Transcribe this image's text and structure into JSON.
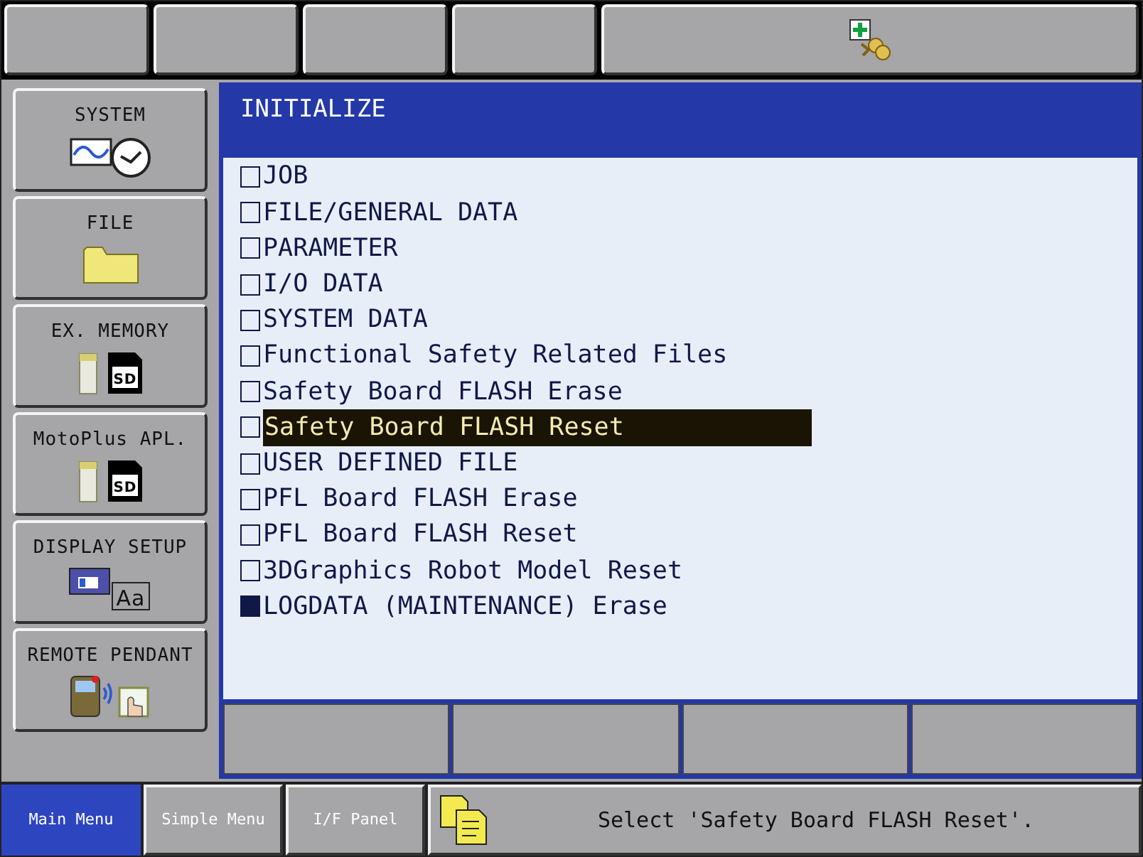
{
  "top_buttons": [
    {
      "kind": "blank"
    },
    {
      "kind": "blank"
    },
    {
      "kind": "blank"
    },
    {
      "kind": "blank"
    },
    {
      "kind": "icon"
    }
  ],
  "sidebar": {
    "items": [
      {
        "label": "SYSTEM",
        "kind": "system"
      },
      {
        "label": "FILE",
        "kind": "file"
      },
      {
        "label": "EX. MEMORY",
        "kind": "memory",
        "icon_text": "SD"
      },
      {
        "label": "MotoPlus APL.",
        "kind": "memory",
        "icon_text": "SD"
      },
      {
        "label": "DISPLAY SETUP",
        "kind": "display",
        "icon_text": "Aa"
      },
      {
        "label": "REMOTE PENDANT",
        "kind": "pendant"
      }
    ]
  },
  "panel": {
    "title": "INITIALIZE",
    "items": [
      {
        "label": "JOB",
        "checked": false,
        "selected": false
      },
      {
        "label": "FILE/GENERAL DATA",
        "checked": false,
        "selected": false
      },
      {
        "label": "PARAMETER",
        "checked": false,
        "selected": false
      },
      {
        "label": "I/O DATA",
        "checked": false,
        "selected": false
      },
      {
        "label": "SYSTEM DATA",
        "checked": false,
        "selected": false
      },
      {
        "label": "Functional Safety Related Files",
        "checked": false,
        "selected": false
      },
      {
        "label": "Safety Board FLASH Erase",
        "checked": false,
        "selected": false
      },
      {
        "label": "Safety Board FLASH Reset",
        "checked": false,
        "selected": true
      },
      {
        "label": "USER DEFINED FILE",
        "checked": false,
        "selected": false
      },
      {
        "label": "PFL Board FLASH Erase",
        "checked": false,
        "selected": false
      },
      {
        "label": "PFL Board FLASH Reset",
        "checked": false,
        "selected": false
      },
      {
        "label": "3DGraphics Robot Model Reset",
        "checked": false,
        "selected": false
      },
      {
        "label": "LOGDATA (MAINTENANCE) Erase",
        "checked": true,
        "selected": false
      }
    ]
  },
  "bottom_tabs": [
    {
      "label": "Main Menu",
      "selected": true
    },
    {
      "label": "Simple Menu",
      "selected": false
    },
    {
      "label": "I/F Panel",
      "selected": false
    }
  ],
  "status_bar": {
    "message": "Select 'Safety Board FLASH Reset'."
  }
}
